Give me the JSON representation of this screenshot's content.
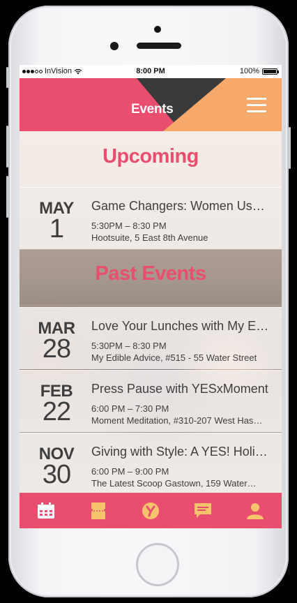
{
  "status_bar": {
    "carrier": "InVision",
    "time": "8:00 PM",
    "battery": "100%"
  },
  "header": {
    "title": "Events",
    "menu_icon": "hamburger-menu-icon"
  },
  "sections": {
    "upcoming_title": "Upcoming",
    "past_title": "Past Events"
  },
  "upcoming_events": [
    {
      "month": "MAY",
      "day": "1",
      "name": "Game Changers: Women Us…",
      "time": "5:30PM – 8:30 PM",
      "venue": "Hootsuite, 5 East 8th Avenue"
    }
  ],
  "past_events": [
    {
      "month": "MAR",
      "day": "28",
      "name": "Love Your Lunches with My E…",
      "time": "5:30PM – 8:30 PM",
      "venue": "My Edible Advice, #515 - 55 Water Street"
    },
    {
      "month": "FEB",
      "day": "22",
      "name": "Press Pause with YESxMoment",
      "time": "6:00 PM – 7:30 PM",
      "venue": "Moment Meditation, #310-207 West Has…"
    },
    {
      "month": "NOV",
      "day": "30",
      "name": "Giving with Style: A YES! Holi…",
      "time": "6:00 PM – 9:00 PM",
      "venue": "The Latest Scoop Gastown, 159 Water…"
    }
  ],
  "tabs": [
    {
      "icon": "calendar-icon",
      "active": true
    },
    {
      "icon": "ticket-icon",
      "active": false
    },
    {
      "icon": "yes-logo-icon",
      "active": false
    },
    {
      "icon": "chat-bubble-icon",
      "active": false
    },
    {
      "icon": "profile-icon",
      "active": false
    }
  ],
  "colors": {
    "brand_pink": "#e94e6e",
    "brand_orange": "#f6a96a",
    "dark_triangle": "#3a3a3a",
    "tab_icon": "#f7c36d",
    "text_dark": "#3e3e3e"
  }
}
